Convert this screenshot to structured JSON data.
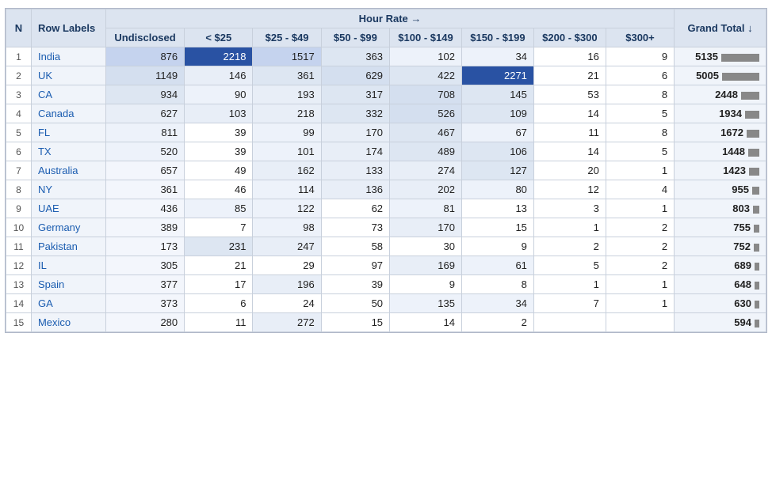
{
  "table": {
    "header": {
      "span_label": "Hour Rate →",
      "cols": [
        "Undisclosed",
        "< $25",
        "$25 - $49",
        "$50 - $99",
        "$100 - $149",
        "$150 - $199",
        "$200 - $300",
        "$300+"
      ],
      "n_label": "N",
      "row_labels_label": "Row Labels",
      "grand_total_label": "Grand Total ↓"
    },
    "rows": [
      {
        "n": 1,
        "label": "India",
        "vals": [
          876,
          2218,
          1517,
          363,
          102,
          34,
          16,
          9
        ],
        "total": 5135,
        "bar": 100
      },
      {
        "n": 2,
        "label": "UK",
        "vals": [
          1149,
          146,
          361,
          629,
          422,
          2271,
          21,
          6
        ],
        "total": 5005,
        "bar": 97
      },
      {
        "n": 3,
        "label": "CA",
        "vals": [
          934,
          90,
          193,
          317,
          708,
          145,
          53,
          8
        ],
        "total": 2448,
        "bar": 47
      },
      {
        "n": 4,
        "label": "Canada",
        "vals": [
          627,
          103,
          218,
          332,
          526,
          109,
          14,
          5
        ],
        "total": 1934,
        "bar": 37
      },
      {
        "n": 5,
        "label": "FL",
        "vals": [
          811,
          39,
          99,
          170,
          467,
          67,
          11,
          8
        ],
        "total": 1672,
        "bar": 32
      },
      {
        "n": 6,
        "label": "TX",
        "vals": [
          520,
          39,
          101,
          174,
          489,
          106,
          14,
          5
        ],
        "total": 1448,
        "bar": 28
      },
      {
        "n": 7,
        "label": "Australia",
        "vals": [
          657,
          49,
          162,
          133,
          274,
          127,
          20,
          1
        ],
        "total": 1423,
        "bar": 27
      },
      {
        "n": 8,
        "label": "NY",
        "vals": [
          361,
          46,
          114,
          136,
          202,
          80,
          12,
          4
        ],
        "total": 955,
        "bar": 18
      },
      {
        "n": 9,
        "label": "UAE",
        "vals": [
          436,
          85,
          122,
          62,
          81,
          13,
          3,
          1
        ],
        "total": 803,
        "bar": 15
      },
      {
        "n": 10,
        "label": "Germany",
        "vals": [
          389,
          7,
          98,
          73,
          170,
          15,
          1,
          2
        ],
        "total": 755,
        "bar": 14
      },
      {
        "n": 11,
        "label": "Pakistan",
        "vals": [
          173,
          231,
          247,
          58,
          30,
          9,
          2,
          2
        ],
        "total": 752,
        "bar": 14
      },
      {
        "n": 12,
        "label": "IL",
        "vals": [
          305,
          21,
          29,
          97,
          169,
          61,
          5,
          2
        ],
        "total": 689,
        "bar": 13
      },
      {
        "n": 13,
        "label": "Spain",
        "vals": [
          377,
          17,
          196,
          39,
          9,
          8,
          1,
          1
        ],
        "total": 648,
        "bar": 12
      },
      {
        "n": 14,
        "label": "GA",
        "vals": [
          373,
          6,
          24,
          50,
          135,
          34,
          7,
          1
        ],
        "total": 630,
        "bar": 12
      },
      {
        "n": 15,
        "label": "Mexico",
        "vals": [
          280,
          11,
          272,
          15,
          14,
          2,
          null,
          null
        ],
        "total": 594,
        "bar": 11
      }
    ],
    "colors": {
      "highlight_dark": "#2952a3",
      "l1": "#c5d3ee",
      "l2": "#d4dfef",
      "l3": "#dde6f2",
      "l4": "#e8eef7",
      "l5": "#edf2fa",
      "l6": "#f3f6fc",
      "header_bg": "#dce4f0"
    }
  }
}
